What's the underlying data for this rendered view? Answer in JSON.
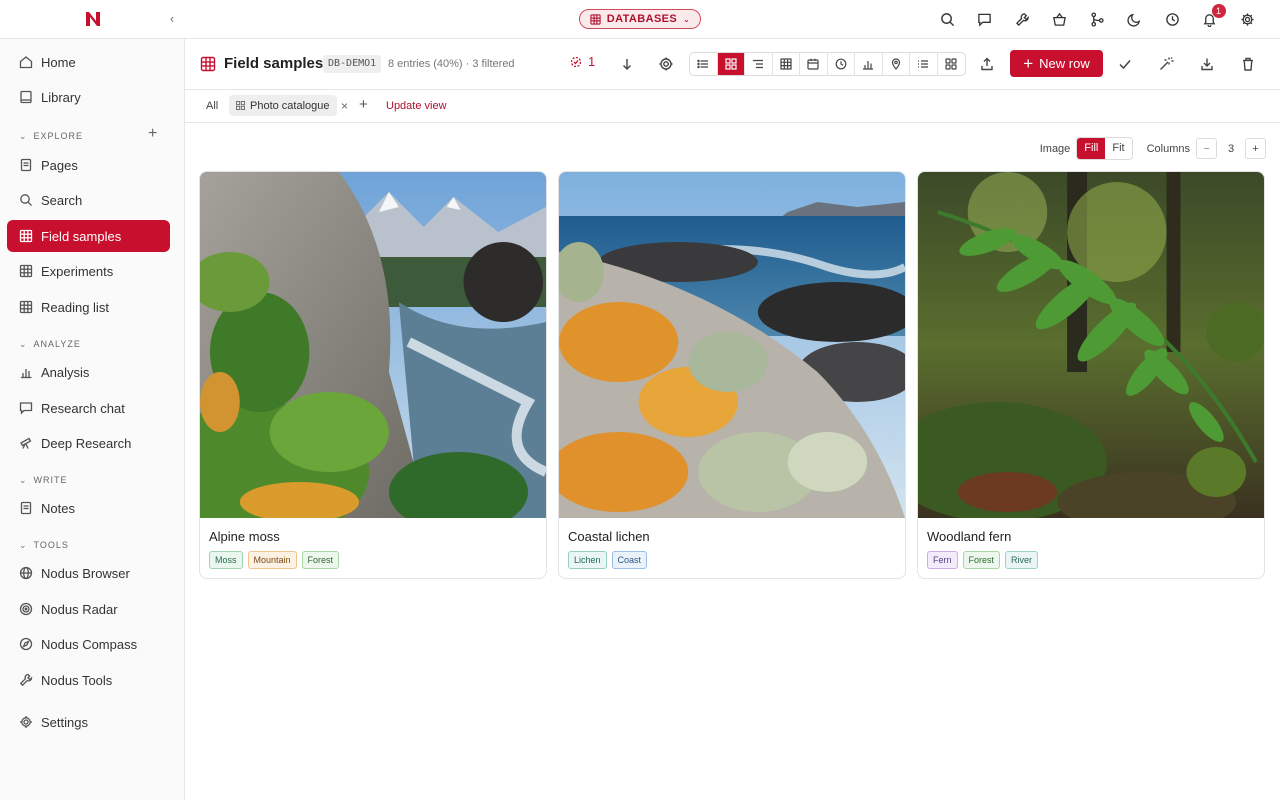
{
  "app": {
    "db_pill_label": "DATABASES",
    "notification_count": "1"
  },
  "sidebar": {
    "top_items": [
      {
        "label": "Home",
        "icon": "home-icon"
      },
      {
        "label": "Library",
        "icon": "book-icon"
      }
    ],
    "sections": {
      "explore": "EXPLORE",
      "analyze": "ANALYZE",
      "write": "WRITE",
      "tools": "TOOLS"
    },
    "explore_items": [
      {
        "label": "Pages"
      },
      {
        "label": "Search"
      },
      {
        "label": "Field samples",
        "active": true
      },
      {
        "label": "Experiments"
      },
      {
        "label": "Reading list"
      }
    ],
    "analyze_items": [
      {
        "label": "Analysis"
      },
      {
        "label": "Research chat"
      },
      {
        "label": "Deep Research"
      }
    ],
    "write_items": [
      {
        "label": "Notes"
      }
    ],
    "tools_items": [
      {
        "label": "Nodus Browser"
      },
      {
        "label": "Nodus Radar"
      },
      {
        "label": "Nodus Compass"
      },
      {
        "label": "Nodus Tools"
      }
    ],
    "settings": "Settings"
  },
  "header": {
    "title": "Field samples",
    "db_code": "DB-DEMO1",
    "entries": "8 entries (40%) · 3 filtered",
    "filter_count": "1",
    "new_row_label": "New row",
    "accent": "#c8102e"
  },
  "tabs": {
    "all": "All",
    "photo": "Photo catalogue",
    "update_view": "Update view"
  },
  "controls": {
    "image_label": "Image",
    "fill": "Fill",
    "fit": "Fit",
    "columns_label": "Columns",
    "columns_value": "3",
    "minus": "−",
    "plus": "+"
  },
  "cards": [
    {
      "title": "Alpine moss",
      "tags": [
        "Moss",
        "Mountain",
        "Forest"
      ]
    },
    {
      "title": "Coastal lichen",
      "tags": [
        "Lichen",
        "Coast"
      ]
    },
    {
      "title": "Woodland fern",
      "tags": [
        "Fern",
        "Forest",
        "River"
      ]
    }
  ],
  "tag_colors": {
    "Moss": {
      "bg": "#eaf7ef",
      "border": "#9fd3b3",
      "color": "#2d6a45"
    },
    "Mountain": {
      "bg": "#fdf1e3",
      "border": "#f0c48c",
      "color": "#7a4c12"
    },
    "Forest": {
      "bg": "#edf7ed",
      "border": "#a8d6a8",
      "color": "#2f6a2f"
    },
    "Lichen": {
      "bg": "#e9f6f3",
      "border": "#95cfc2",
      "color": "#24675a"
    },
    "Coast": {
      "bg": "#eaf2fb",
      "border": "#9dbde3",
      "color": "#2c5686"
    },
    "Fern": {
      "bg": "#f3ecfb",
      "border": "#c9afe6",
      "color": "#5a3a86"
    },
    "River": {
      "bg": "#eaf6f3",
      "border": "#a0d2c6",
      "color": "#2a6658"
    }
  }
}
